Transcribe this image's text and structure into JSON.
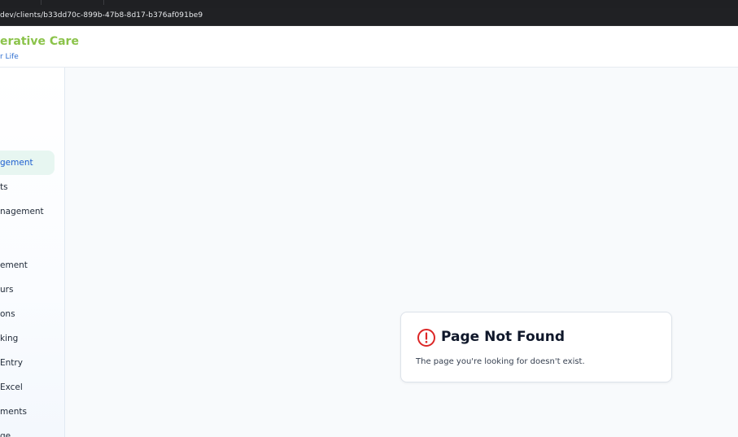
{
  "browser": {
    "url": "dev/clients/b33dd70c-899b-47b8-8d17-b376af091be9"
  },
  "header": {
    "brand": "erative Care",
    "tagline": "r Life"
  },
  "sidebar": {
    "items": [
      {
        "label": "gement",
        "active": true
      },
      {
        "label": "ts",
        "active": false
      },
      {
        "label": "nagement",
        "active": false
      },
      {
        "label": "ement",
        "active": false
      },
      {
        "label": "urs",
        "active": false
      },
      {
        "label": "ons",
        "active": false
      },
      {
        "label": "king",
        "active": false
      },
      {
        "label": " Entry",
        "active": false
      },
      {
        "label": " Excel",
        "active": false
      },
      {
        "label": "ments",
        "active": false
      },
      {
        "label": "ge",
        "active": false
      }
    ]
  },
  "error_card": {
    "icon": "alert-circle-icon",
    "icon_color": "#dc2626",
    "title": "Page Not Found",
    "message": "The page you're looking for doesn't exist."
  },
  "colors": {
    "brand": "#8bc34a",
    "tagline": "#2f6fd1",
    "active_item_bg": "#e7f6f1",
    "active_item_text": "#1d5fd0"
  }
}
